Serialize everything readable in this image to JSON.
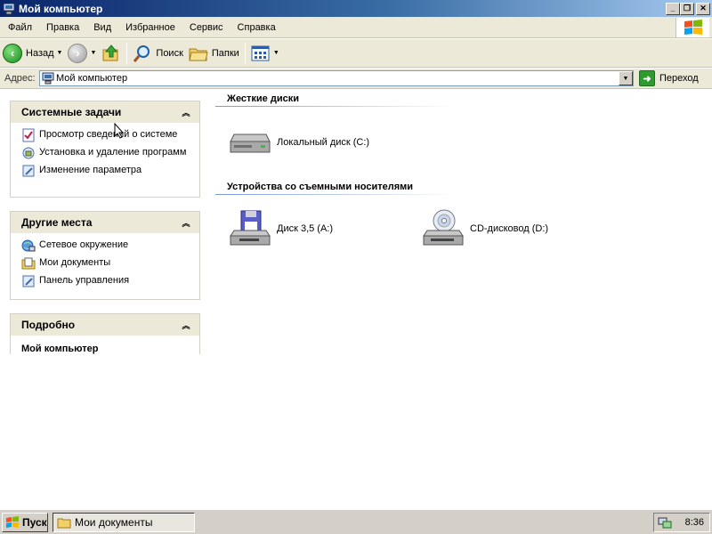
{
  "window": {
    "title": "Мой компьютер"
  },
  "menu": [
    "Файл",
    "Правка",
    "Вид",
    "Избранное",
    "Сервис",
    "Справка"
  ],
  "toolbar": {
    "back_label": "Назад",
    "search_label": "Поиск",
    "folders_label": "Папки"
  },
  "address": {
    "label": "Адрес:",
    "value": "Мой компьютер",
    "go_label": "Переход"
  },
  "panels": {
    "system": {
      "title": "Системные задачи",
      "items": [
        "Просмотр сведений о системе",
        "Установка и удаление программ",
        "Изменение параметра"
      ]
    },
    "places": {
      "title": "Другие места",
      "items": [
        "Сетевое окружение",
        "Мои документы",
        "Панель управления"
      ]
    },
    "details": {
      "title": "Подробно",
      "name": "Мой компьютер"
    }
  },
  "sections": {
    "hard_disks": {
      "title": "Жесткие диски",
      "items": [
        "Локальный диск (C:)"
      ]
    },
    "removable": {
      "title": "Устройства со съемными носителями",
      "items": [
        "Диск 3,5 (A:)",
        "CD-дисковод (D:)"
      ]
    }
  },
  "taskbar": {
    "start_label": "Пуск",
    "task_label": "Мои документы",
    "clock": "8:36"
  },
  "colors": {
    "title_start": "#0a246a",
    "title_end": "#a6caf0",
    "face": "#ece9d8",
    "link_line": "#7a96df"
  }
}
